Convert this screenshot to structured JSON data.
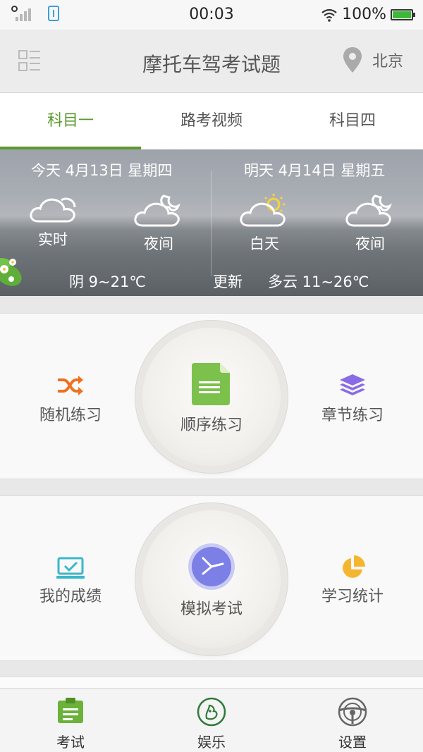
{
  "status_bar": {
    "time": "00:03",
    "battery": "100%",
    "battery_level": 1.0,
    "icons": [
      "signal-icon",
      "usb-icon",
      "wifi-icon",
      "battery-icon"
    ]
  },
  "header": {
    "title": "摩托车驾考试题",
    "location": "北京",
    "icons": [
      "menu-icon",
      "location-pin-icon"
    ]
  },
  "tabs": [
    {
      "label": "科目一",
      "active": true
    },
    {
      "label": "路考视频",
      "active": false
    },
    {
      "label": "科目四",
      "active": false
    }
  ],
  "weather": {
    "today": {
      "date": "今天 4月13日 星期四",
      "items": [
        {
          "label": "实时",
          "icon": "cloudy-icon"
        },
        {
          "label": "夜间",
          "icon": "cloudy-night-icon"
        }
      ],
      "summary": "阴 9~21℃"
    },
    "tomorrow": {
      "date": "明天 4月14日 星期五",
      "items": [
        {
          "label": "白天",
          "icon": "partly-sunny-icon"
        },
        {
          "label": "夜间",
          "icon": "cloudy-night-icon"
        }
      ],
      "update_label": "更新",
      "summary": "多云 11~26℃"
    }
  },
  "practice": {
    "random": {
      "label": "随机练习",
      "icon": "shuffle-icon"
    },
    "sequential": {
      "label": "顺序练习",
      "icon": "document-icon"
    },
    "chapter": {
      "label": "章节练习",
      "icon": "layers-icon"
    }
  },
  "exam": {
    "my_scores": {
      "label": "我的成绩",
      "icon": "laptop-check-icon"
    },
    "mock_exam": {
      "label": "模拟考试",
      "icon": "clock-icon"
    },
    "statistics": {
      "label": "学习统计",
      "icon": "pie-chart-icon"
    }
  },
  "bottom_nav": [
    {
      "label": "考试",
      "icon": "clipboard-icon",
      "active": true
    },
    {
      "label": "娱乐",
      "icon": "entertainment-icon",
      "active": false
    },
    {
      "label": "设置",
      "icon": "steering-wheel-icon",
      "active": false
    }
  ],
  "colors": {
    "accent": "#5a9a2c",
    "shuffle": "#f07020",
    "layers": "#8a6be6",
    "document": "#7cc14c",
    "laptop": "#3bb8c8",
    "pie": "#f5b52e",
    "clock": "#7b7fe6"
  }
}
